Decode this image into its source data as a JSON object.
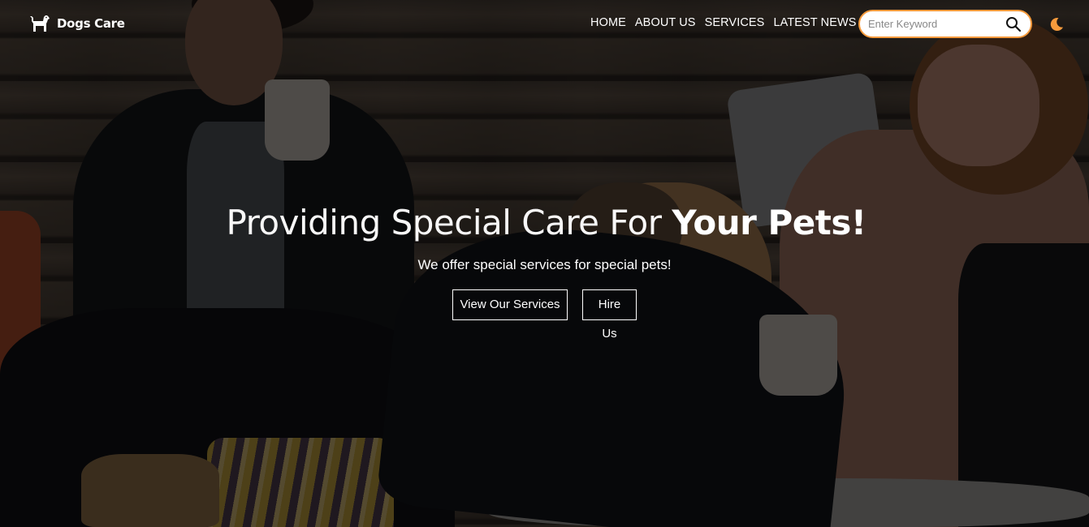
{
  "brand": {
    "name": "Dogs Care",
    "logo_icon": "dog-icon"
  },
  "nav": {
    "items": [
      {
        "label": "HOME"
      },
      {
        "label": "ABOUT US"
      },
      {
        "label": "SERVICES"
      },
      {
        "label": "LATEST NEWS"
      }
    ]
  },
  "search": {
    "placeholder": "Enter Keyword",
    "value": "",
    "icon": "search-icon"
  },
  "theme_toggle": {
    "icon": "moon-icon"
  },
  "hero": {
    "title_light": "Providing Special Care For ",
    "title_bold": "Your Pets!",
    "subtitle": "We offer special services for special pets!",
    "buttons": [
      {
        "label": "View Our Services"
      },
      {
        "label": "Hire Us"
      }
    ]
  },
  "colors": {
    "accent": "#f59a3c",
    "text": "#ffffff",
    "overlay": "rgba(0,0,0,0.58)"
  }
}
